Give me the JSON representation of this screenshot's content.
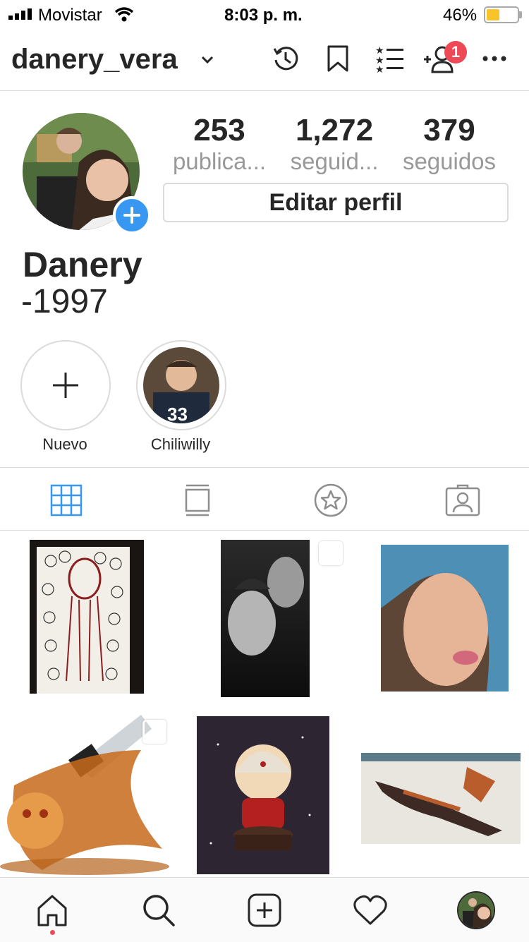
{
  "status_bar": {
    "carrier": "Movistar",
    "time": "8:03 p. m.",
    "battery_pct": "46%"
  },
  "header": {
    "username": "danery_vera",
    "notification_count": "1",
    "icons": [
      "chevron-down-icon",
      "archive-clock-icon",
      "bookmark-icon",
      "close-friends-list-icon",
      "add-person-icon",
      "more-icon"
    ]
  },
  "profile": {
    "stats": [
      {
        "value": "253",
        "label": "publica..."
      },
      {
        "value": "1,272",
        "label": "seguid..."
      },
      {
        "value": "379",
        "label": "seguidos"
      }
    ],
    "edit_button": "Editar perfil",
    "display_name": "Danery",
    "bio": "-1997"
  },
  "highlights": [
    {
      "label": "Nuevo"
    },
    {
      "label": "Chiliwilly"
    }
  ],
  "tabs": [
    "grid-tab",
    "feed-tab",
    "tagged-star-tab",
    "tagged-person-tab"
  ],
  "colors": {
    "accent": "#3897f0",
    "badge": "#ed4956",
    "border": "#dbdbdb",
    "text": "#262626",
    "muted": "#999999"
  }
}
